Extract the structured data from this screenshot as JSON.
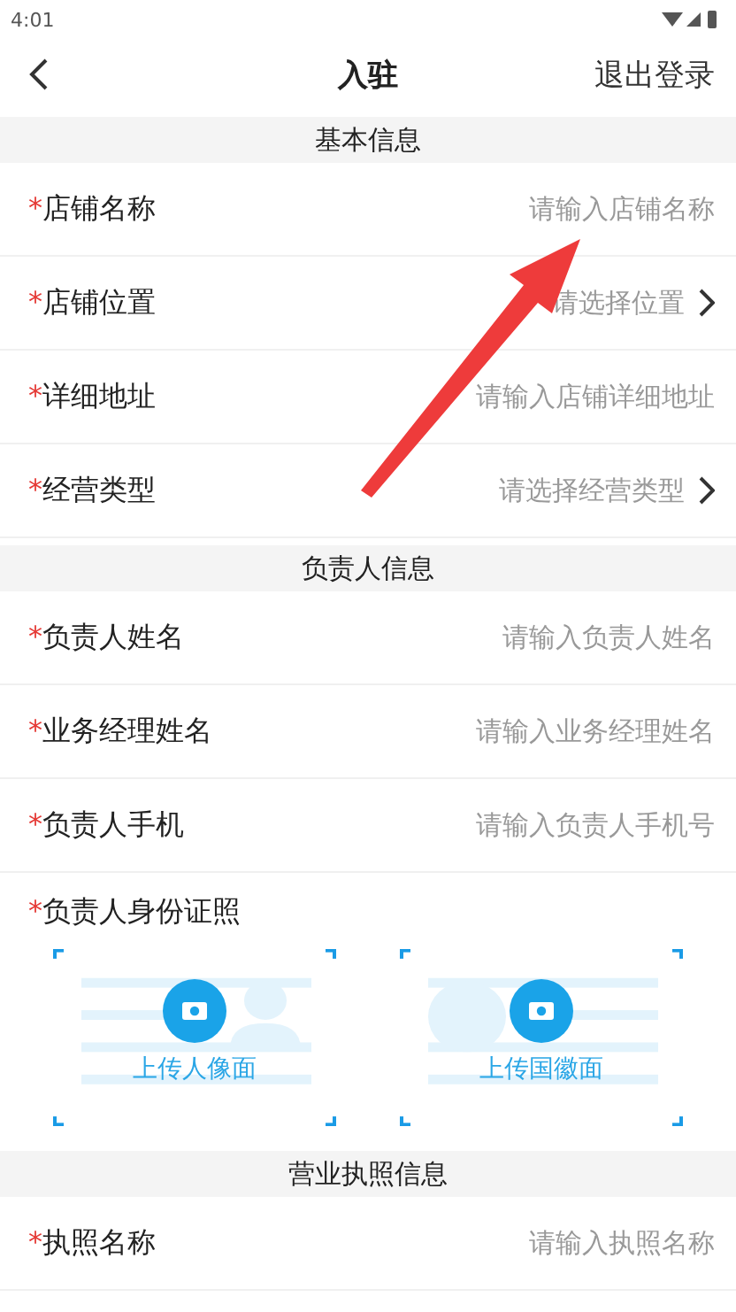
{
  "status_bar": {
    "time": "4:01"
  },
  "header": {
    "title": "入驻",
    "action": "退出登录"
  },
  "sections": [
    {
      "title": "基本信息",
      "rows": [
        {
          "kind": "input",
          "mark": "*",
          "label": "店铺名称",
          "placeholder": "请输入店铺名称"
        },
        {
          "kind": "select",
          "mark": "*",
          "label": "店铺位置",
          "placeholder": "请选择位置"
        },
        {
          "kind": "input",
          "mark": "*",
          "label": "详细地址",
          "placeholder": "请输入店铺详细地址"
        },
        {
          "kind": "select",
          "mark": "*",
          "label": "经营类型",
          "placeholder": "请选择经营类型"
        }
      ]
    },
    {
      "title": "负责人信息",
      "rows": [
        {
          "kind": "input",
          "mark": "*",
          "label": "负责人姓名",
          "placeholder": "请输入负责人姓名"
        },
        {
          "kind": "input",
          "mark": "*",
          "label": "业务经理姓名",
          "placeholder": "请输入业务经理姓名"
        },
        {
          "kind": "input",
          "mark": "*",
          "label": "负责人手机",
          "placeholder": "请输入负责人手机号"
        },
        {
          "kind": "upload",
          "mark": "*",
          "label": "负责人身份证照",
          "uploads": [
            {
              "kind": "portrait",
              "caption": "上传人像面"
            },
            {
              "kind": "emblem",
              "caption": "上传国徽面"
            }
          ]
        }
      ]
    },
    {
      "title": "营业执照信息",
      "rows": [
        {
          "kind": "input",
          "mark": "*",
          "label": "执照名称",
          "placeholder": "请输入执照名称"
        }
      ]
    }
  ]
}
